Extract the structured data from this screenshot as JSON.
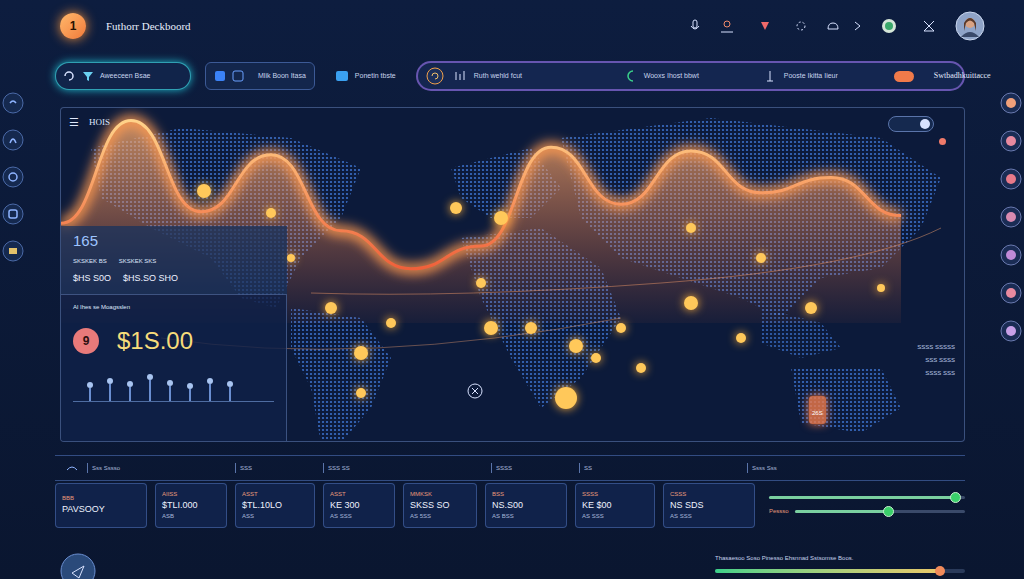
{
  "app": {
    "logo": "1",
    "title": "Futhorr Deckboord"
  },
  "filters": [
    {
      "label": "Aweeceen Bsae"
    },
    {
      "label": "Mlik Boon Itasa"
    },
    {
      "label": "Ponetin tbste"
    }
  ],
  "toolbar": {
    "items": [
      "Ruth wehld fcut",
      "Wooxs Ihost bbwt",
      "Pooste Ikitta Iieur"
    ],
    "toggle_on": true,
    "action": "Swtbadhkuittacce"
  },
  "map_panel": {
    "menu_icon": "☰",
    "title": "HOIS",
    "chart": {
      "series": [
        {
          "values": [
            42,
            96,
            48,
            78,
            38,
            18,
            30,
            82,
            52,
            80,
            58,
            66,
            46
          ]
        }
      ]
    },
    "toggle_on": true,
    "labels": [
      "SSSS SSSSS",
      "SSS SSSS",
      "SSSS SSS"
    ],
    "marker": "26S"
  },
  "stats": {
    "value": "165",
    "labels": [
      "SKSKEK BS",
      "SKSKEK SKS"
    ],
    "amounts": [
      "$HS S0O",
      "$HS.SO SHO"
    ]
  },
  "revenue": {
    "title": "Al Ihes se Moagsslen",
    "badge": "9",
    "amount": "$1S.00",
    "levels": [
      0.45,
      0.6,
      0.5,
      0.75,
      0.55,
      0.42,
      0.62,
      0.5
    ]
  },
  "strip": {
    "headers": [
      "Sss Sssso",
      "SSS",
      "SSS SS",
      "SSSS",
      "SS",
      "Ssss Sss"
    ]
  },
  "cards": [
    {
      "label": "BBB",
      "value": "PAVSOOY"
    },
    {
      "label": "AIISS",
      "value": "$TLI.000",
      "sub": "ASB"
    },
    {
      "label": "ASST",
      "value": "$TL.10LO",
      "sub": "ASS"
    },
    {
      "label": "ASST",
      "value": "KE 300",
      "sub": "AS SSS"
    },
    {
      "label": "MMKSK",
      "value": "SKSS SO",
      "sub": "AS 5SS"
    },
    {
      "label": "BSS",
      "value": "NS.S00",
      "sub": "AS BSS"
    },
    {
      "label": "SSSS",
      "value": "KE $00",
      "sub": "AS SSS"
    },
    {
      "label": "CSSS",
      "value": "NS SDS",
      "sub": "AS SSS"
    }
  ],
  "sliders": [
    {
      "level": 0.95
    },
    {
      "label": "Pessso",
      "level": 0.55
    }
  ],
  "footer": {
    "text": "Thasaesoo Soso Pinesso Ehsnnad Sstsomse Boos.",
    "progress": 0.9
  }
}
